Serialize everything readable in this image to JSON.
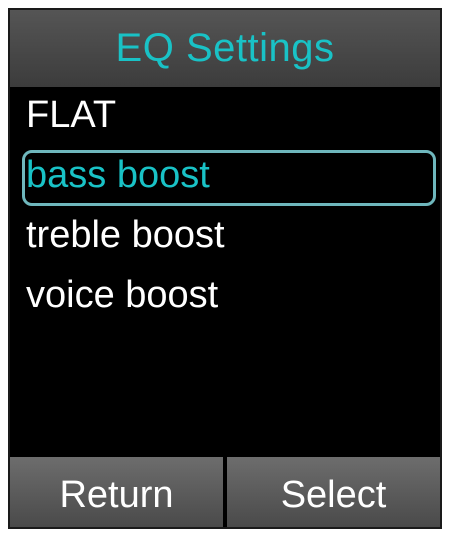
{
  "title": "EQ Settings",
  "menu": {
    "items": [
      {
        "label": "FLAT"
      },
      {
        "label": "bass boost"
      },
      {
        "label": "treble boost"
      },
      {
        "label": "voice boost"
      }
    ],
    "selected_index": 1
  },
  "softkeys": {
    "left_label": "Return",
    "right_label": "Select"
  },
  "colors": {
    "accent": "#19c2c6",
    "highlight_border": "#6fb7bd",
    "title_bar": "#4a4a4a",
    "background": "#000000",
    "text": "#ffffff",
    "softkey_bg": "#5a5a5a"
  }
}
